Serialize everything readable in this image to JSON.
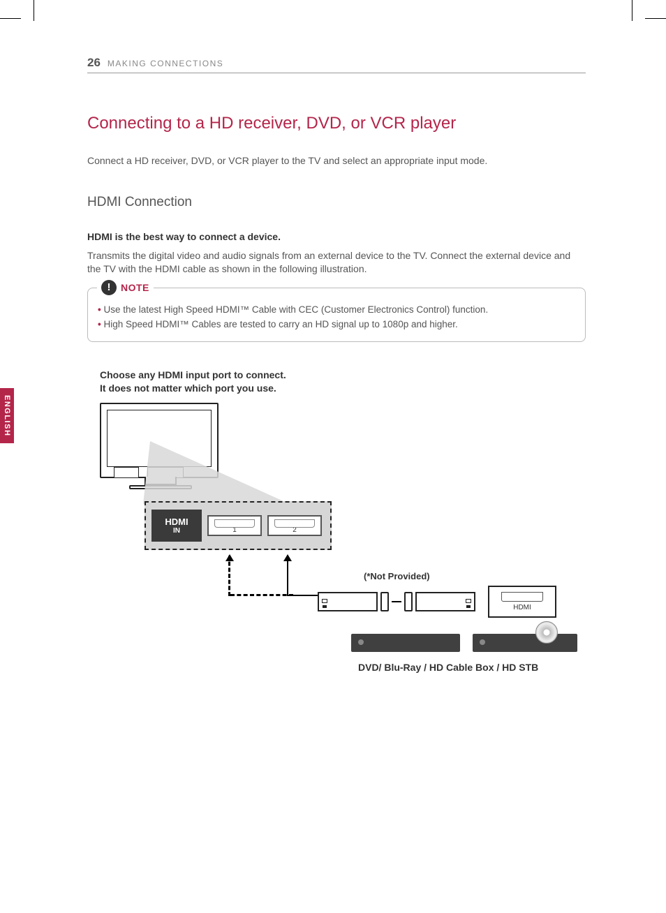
{
  "header": {
    "page_number": "26",
    "section": "MAKING CONNECTIONS"
  },
  "side_tab": "ENGLISH",
  "title": "Connecting to a HD receiver, DVD, or VCR player",
  "intro": "Connect a HD receiver, DVD, or VCR player to the TV and select an appropriate input mode.",
  "subheading": "HDMI Connection",
  "bold_line": "HDMI is the best way to connect a device.",
  "body": "Transmits the digital video and audio signals from an external device to the TV. Connect the external device and the TV with the HDMI cable as shown in the following illustration.",
  "note": {
    "label": "NOTE",
    "items": [
      "Use the latest High Speed HDMI™ Cable with CEC (Customer Electronics Control) function.",
      "High Speed HDMI™ Cables are tested to carry an HD signal up to 1080p and higher."
    ]
  },
  "diagram": {
    "choose_text_l1": "Choose any HDMI input port to connect.",
    "choose_text_l2": "It does not matter which port you use.",
    "hdmi_logo": "HDMI",
    "hdmi_in": "IN",
    "port1": "1",
    "port2": "2",
    "not_provided": "(*Not Provided)",
    "hdmi_out_label": "HDMI",
    "devices_label": "DVD/ Blu-Ray / HD Cable Box / HD STB"
  }
}
